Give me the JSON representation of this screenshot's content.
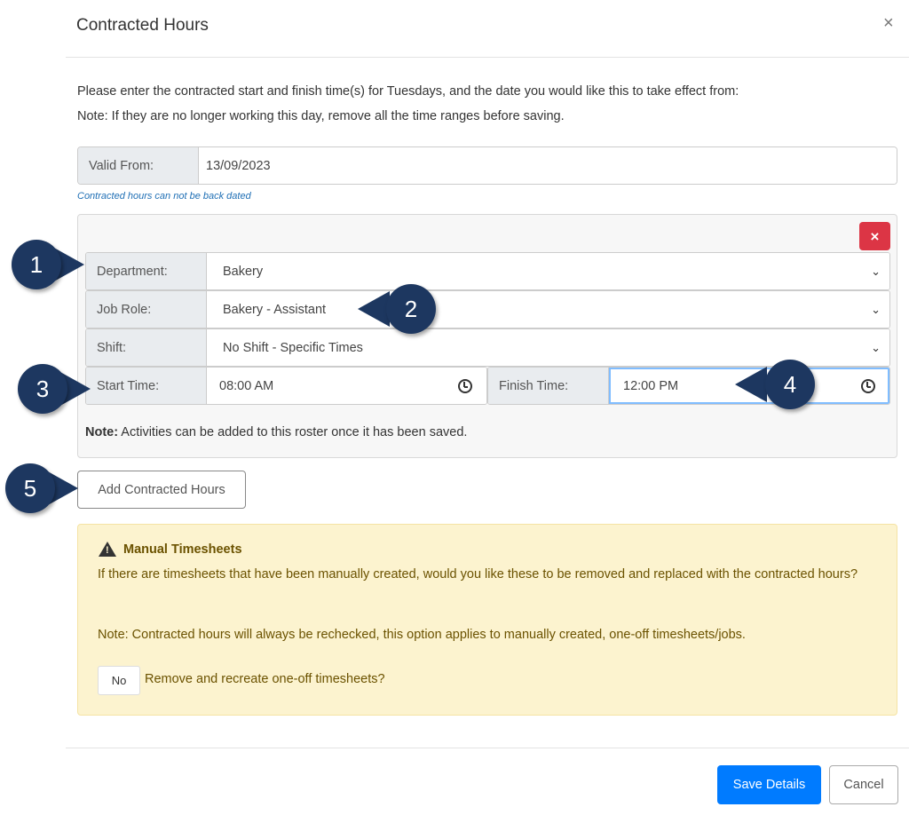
{
  "modal": {
    "title": "Contracted Hours",
    "close_label": "×",
    "intro_line1": "Please enter the contracted start and finish time(s) for Tuesdays, and the date you would like this to take effect from:",
    "intro_line2": "Note: If they are no longer working this day, remove all the time ranges before saving."
  },
  "valid_from": {
    "label": "Valid From:",
    "value": "13/09/2023",
    "hint": "Contracted hours can not be back dated"
  },
  "roster": {
    "delete_label": "×",
    "department": {
      "label": "Department:",
      "value": "Bakery"
    },
    "job_role": {
      "label": "Job Role:",
      "value": "Bakery - Assistant"
    },
    "shift": {
      "label": "Shift:",
      "value": "No Shift - Specific Times"
    },
    "start_time": {
      "label": "Start Time:",
      "value": "08:00 AM"
    },
    "finish_time": {
      "label": "Finish Time:",
      "value": "12:00 PM"
    },
    "note_bold": "Note:",
    "note_text": " Activities can be added to this roster once it has been saved."
  },
  "add_button_label": "Add Contracted Hours",
  "manual_timesheets": {
    "icon": "warning-icon",
    "title": "Manual Timesheets",
    "question": "If there are timesheets that have been manually created, would you like these to be removed and replaced with the contracted hours?",
    "note": "Note: Contracted hours will always be rechecked, this option applies to manually created, one-off timesheets/jobs.",
    "toggle_value": "No",
    "toggle_label": "Remove and recreate one-off timesheets?"
  },
  "footer": {
    "save_label": "Save Details",
    "cancel_label": "Cancel"
  },
  "callouts": [
    "1",
    "2",
    "3",
    "4",
    "5"
  ],
  "colors": {
    "primary": "#007bff",
    "danger": "#dc3545",
    "callout": "#1d3760",
    "warning_bg": "#fcf3cf"
  }
}
